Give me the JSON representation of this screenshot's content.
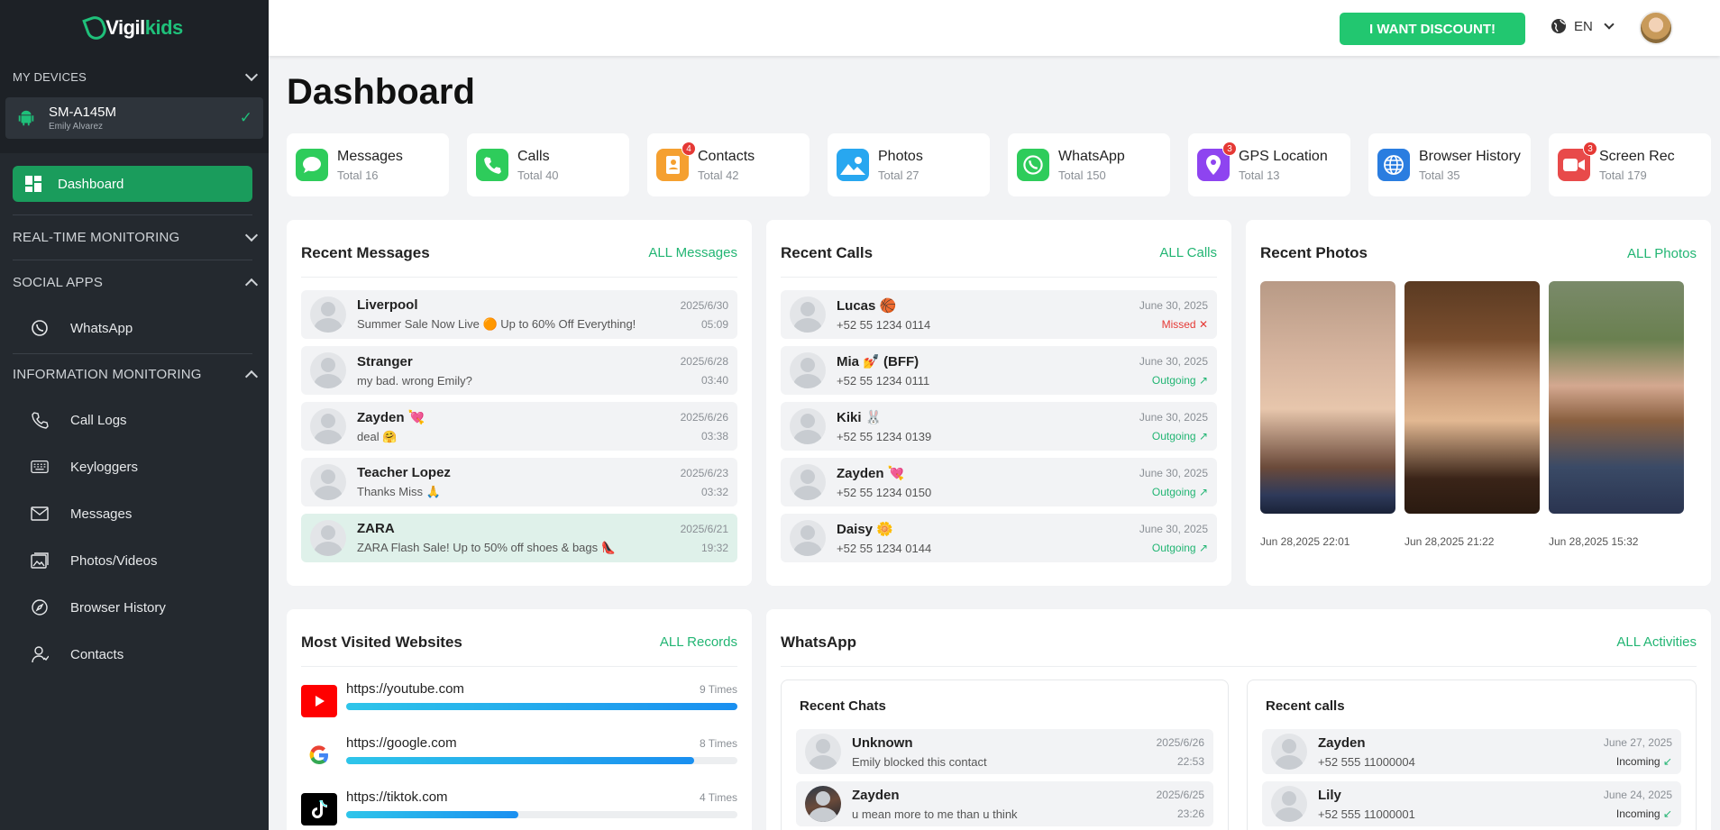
{
  "brand": {
    "name_a": "Vigil",
    "name_b": "kids"
  },
  "sidebar": {
    "devices_header": "MY DEVICES",
    "device": {
      "name": "SM-A145M",
      "owner": "Emily Alvarez"
    },
    "dashboard": "Dashboard",
    "realtime": "REAL-TIME MONITORING",
    "social": "SOCIAL APPS",
    "whatsapp": "WhatsApp",
    "info": "INFORMATION MONITORING",
    "items": [
      "Call Logs",
      "Keyloggers",
      "Messages",
      "Photos/Videos",
      "Browser History",
      "Contacts"
    ]
  },
  "topbar": {
    "discount": "I WANT DISCOUNT!",
    "lang": "EN"
  },
  "page_title": "Dashboard",
  "stats": [
    {
      "label": "Messages",
      "total": "Total 16",
      "color": "#2ecc5b",
      "badge": ""
    },
    {
      "label": "Calls",
      "total": "Total 40",
      "color": "#2ecc5b",
      "badge": ""
    },
    {
      "label": "Contacts",
      "total": "Total 42",
      "color": "#f5a030",
      "badge": "4"
    },
    {
      "label": "Photos",
      "total": "Total 27",
      "color": "#28a7f0",
      "badge": ""
    },
    {
      "label": "WhatsApp",
      "total": "Total 150",
      "color": "#2ecc5b",
      "badge": ""
    },
    {
      "label": "GPS Location",
      "total": "Total 13",
      "color": "#8e44f0",
      "badge": "3"
    },
    {
      "label": "Browser History",
      "total": "Total 35",
      "color": "#2a7de0",
      "badge": ""
    },
    {
      "label": "Screen Rec",
      "total": "Total 179",
      "color": "#e84a4a",
      "badge": "3"
    }
  ],
  "recent_messages": {
    "title": "Recent Messages",
    "all": "ALL Messages",
    "rows": [
      {
        "name": "Liverpool",
        "text": "Summer Sale Now Live 🟠 Up to 60% Off Everything!",
        "date": "2025/6/30",
        "time": "05:09"
      },
      {
        "name": "Stranger",
        "text": "my bad. wrong Emily?",
        "date": "2025/6/28",
        "time": "03:40"
      },
      {
        "name": "Zayden 💘",
        "text": "deal 🤗",
        "date": "2025/6/26",
        "time": "03:38"
      },
      {
        "name": "Teacher Lopez",
        "text": "Thanks Miss 🙏",
        "date": "2025/6/23",
        "time": "03:32"
      },
      {
        "name": "ZARA",
        "text": "ZARA Flash Sale! Up to 50% off shoes & bags 👠",
        "date": "2025/6/21",
        "time": "19:32"
      }
    ]
  },
  "recent_calls": {
    "title": "Recent Calls",
    "all": "ALL Calls",
    "rows": [
      {
        "name": "Lucas 🏀",
        "number": "+52 55 1234 0114",
        "date": "June 30, 2025",
        "status": "Missed",
        "sym": "✕"
      },
      {
        "name": "Mia 💅 (BFF)",
        "number": "+52 55 1234 0111",
        "date": "June 30, 2025",
        "status": "Outgoing",
        "sym": "↗"
      },
      {
        "name": "Kiki 🐰",
        "number": "+52 55 1234 0139",
        "date": "June 30, 2025",
        "status": "Outgoing",
        "sym": "↗"
      },
      {
        "name": "Zayden 💘",
        "number": "+52 55 1234 0150",
        "date": "June 30, 2025",
        "status": "Outgoing",
        "sym": "↗"
      },
      {
        "name": "Daisy 🌼",
        "number": "+52 55 1234 0144",
        "date": "June 30, 2025",
        "status": "Outgoing",
        "sym": "↗"
      }
    ]
  },
  "recent_photos": {
    "title": "Recent Photos",
    "all": "ALL Photos",
    "captions": [
      "Jun 28,2025 22:01",
      "Jun 28,2025 21:22",
      "Jun 28,2025 15:32"
    ]
  },
  "websites": {
    "title": "Most Visited Websites",
    "all": "ALL Records",
    "rows": [
      {
        "url": "https://youtube.com",
        "count": "9 Times",
        "ratio": 1.0
      },
      {
        "url": "https://google.com",
        "count": "8 Times",
        "ratio": 0.89
      },
      {
        "url": "https://tiktok.com",
        "count": "4 Times",
        "ratio": 0.44
      }
    ]
  },
  "whatsapp": {
    "title": "WhatsApp",
    "all": "ALL Activities",
    "chats_title": "Recent Chats",
    "chats": [
      {
        "name": "Unknown",
        "text": "Emily blocked this contact",
        "date": "2025/6/26",
        "time": "22:53"
      },
      {
        "name": "Zayden",
        "text": "u mean more to me than u think",
        "date": "2025/6/25",
        "time": "23:26"
      }
    ],
    "calls_title": "Recent calls",
    "calls": [
      {
        "name": "Zayden",
        "number": "+52 555 11000004",
        "date": "June 27, 2025",
        "status": "Incoming",
        "sym": "↙"
      },
      {
        "name": "Lily",
        "number": "+52 555 11000001",
        "date": "June 24, 2025",
        "status": "Incoming",
        "sym": "↙"
      }
    ]
  }
}
